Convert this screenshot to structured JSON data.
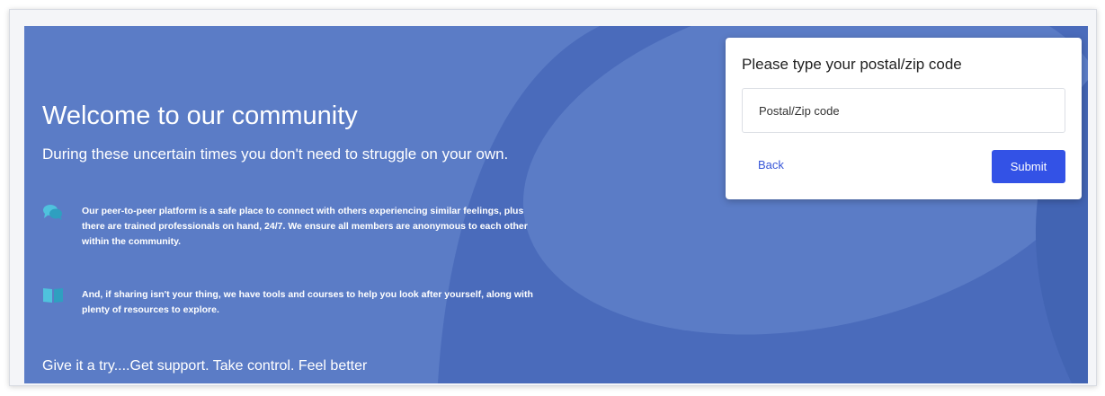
{
  "hero": {
    "title": "Welcome to our community",
    "subtitle": "During these uncertain times you don't need to struggle on your own.",
    "features": [
      {
        "icon": "chat-bubbles-icon",
        "text": "Our peer-to-peer platform is a safe place to connect with others experiencing similar feelings, plus there are trained professionals on hand, 24/7. We ensure all members are anonymous to each other within the community."
      },
      {
        "icon": "open-book-icon",
        "text": "And, if sharing isn't your thing, we have tools and courses to help you look after yourself, along with plenty of resources to explore."
      }
    ],
    "tagline": "Give it a try....Get support. Take control. Feel better"
  },
  "form": {
    "title": "Please type your postal/zip code",
    "zip_placeholder": "Postal/Zip code",
    "zip_value": "",
    "back_label": "Back",
    "submit_label": "Submit"
  },
  "colors": {
    "hero_background": "#5b7cc6",
    "hero_shape_dark": "#4467b6",
    "icon_teal": "#4fc2dd",
    "submit_button": "#3352e6",
    "link": "#3756d8"
  }
}
